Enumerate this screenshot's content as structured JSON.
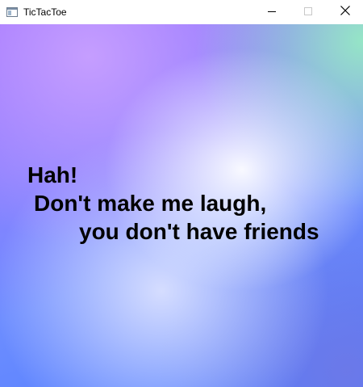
{
  "window": {
    "title": "TicTacToe",
    "icon": "app-window-icon",
    "controls": [
      "minimize-icon",
      "maximize-icon",
      "close-icon"
    ]
  },
  "message": {
    "line1": "Hah!",
    "line2": "Don't make me laugh,",
    "line3": "you don't have friends"
  },
  "colors": {
    "text": "#000000",
    "titlebar_bg": "#ffffff",
    "gradient_purple": "#9a6cff",
    "gradient_blue": "#4f7dff",
    "gradient_mint": "#96ebc3",
    "gradient_center": "#ffffff"
  }
}
